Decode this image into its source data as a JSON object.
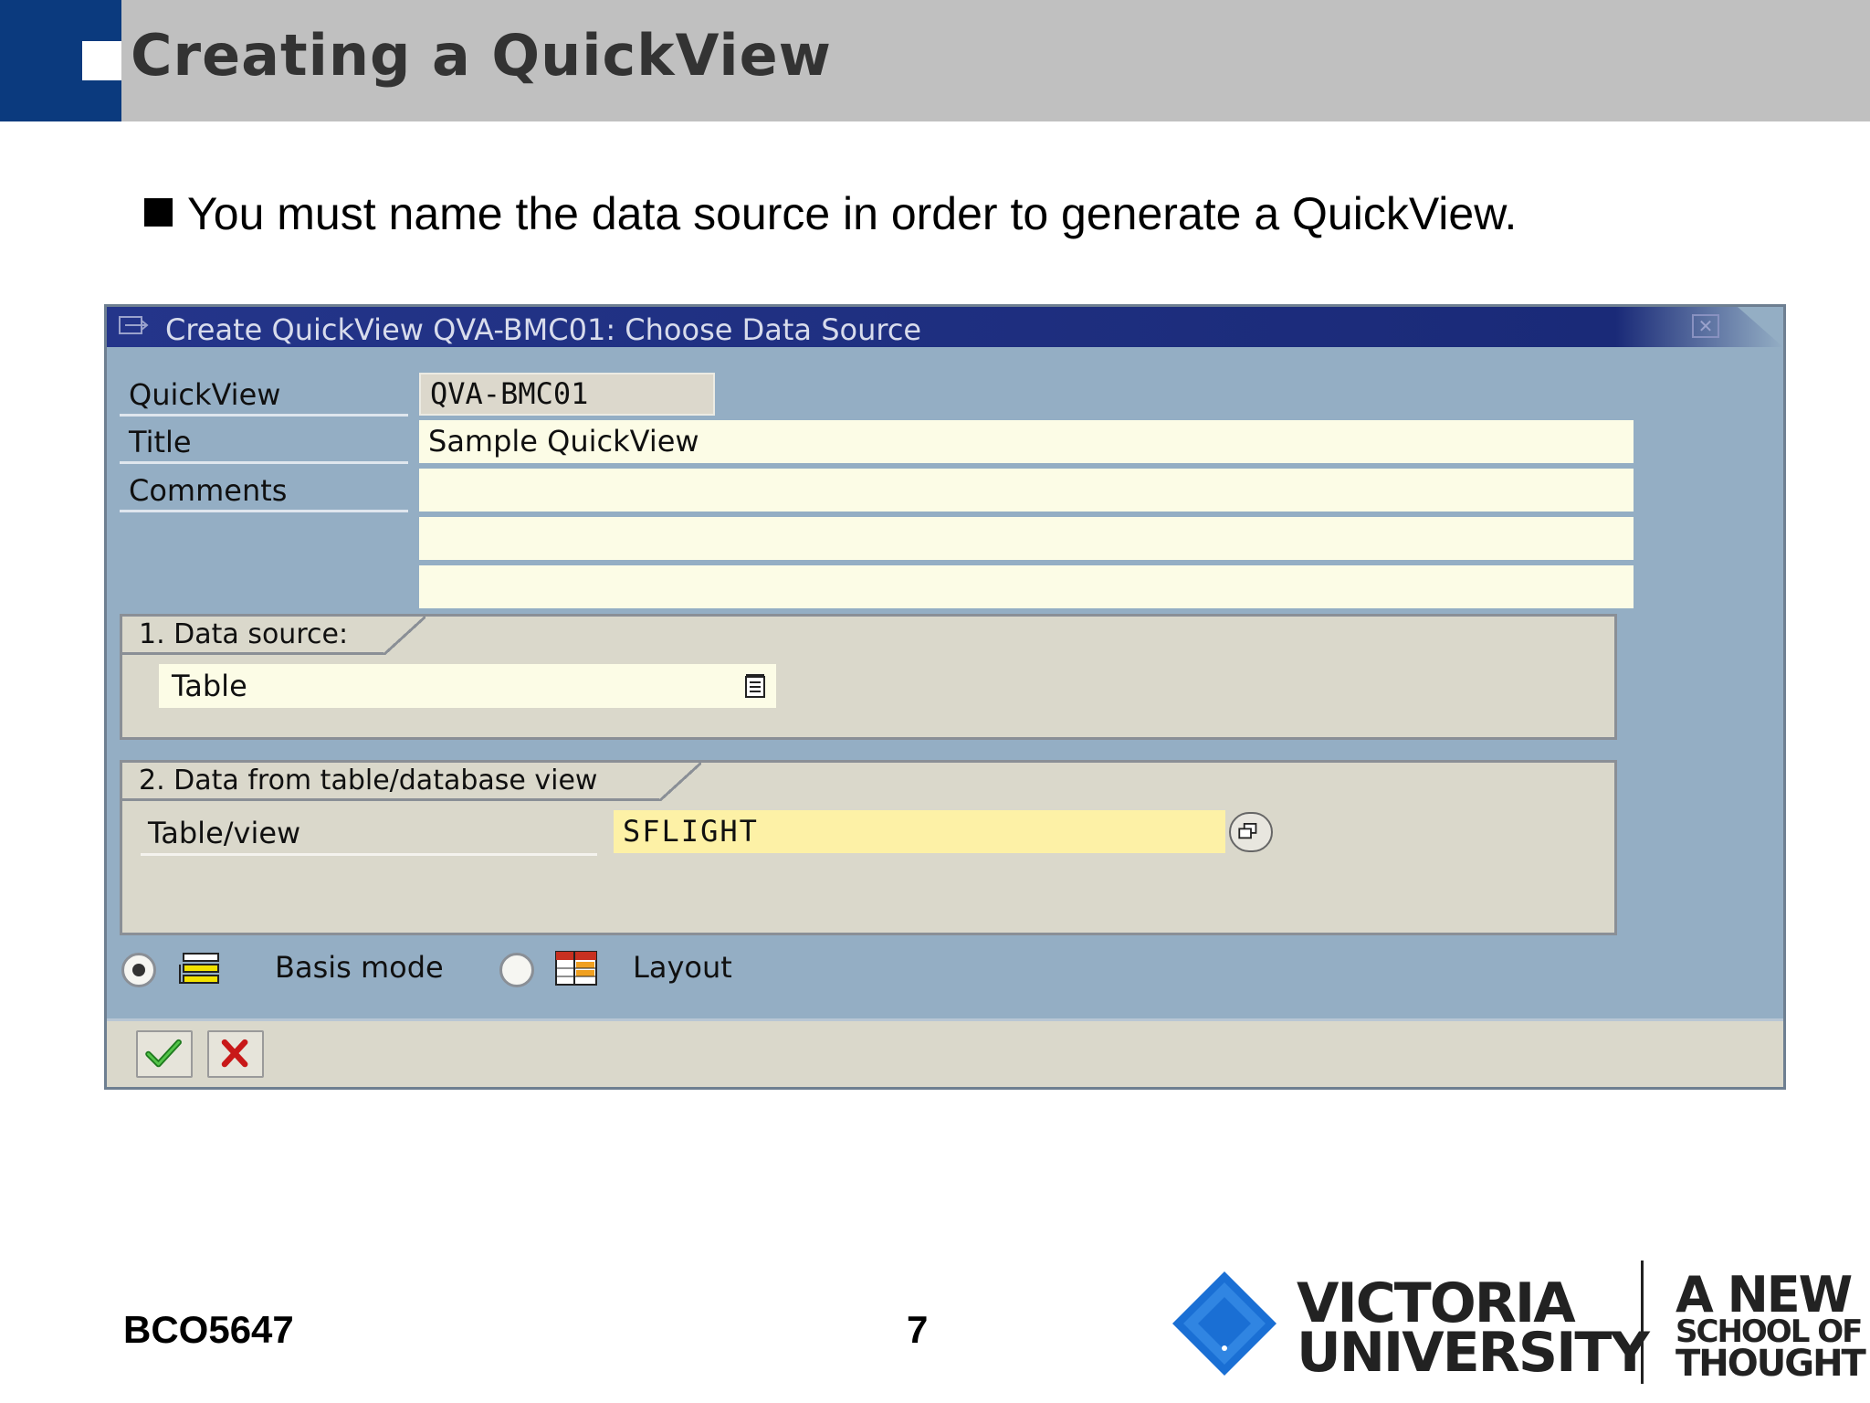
{
  "slide": {
    "title": "Creating a QuickView",
    "bullet": "You must name the data source in order to generate a QuickView.",
    "course_code": "BCO5647",
    "page_number": "7"
  },
  "dialog": {
    "title": "Create QuickView QVA-BMC01: Choose Data Source",
    "fields": {
      "quickview_label": "QuickView",
      "quickview_value": "QVA-BMC01",
      "title_label": "Title",
      "title_value": "Sample QuickView",
      "comments_label": "Comments",
      "comments_value_1": "",
      "comments_value_2": "",
      "comments_value_3": ""
    },
    "data_source_group": {
      "label": "1. Data source:",
      "selected": "Table"
    },
    "table_group": {
      "label": "2. Data from table/database view",
      "table_view_label": "Table/view",
      "table_view_value": "SFLIGHT"
    },
    "mode": {
      "basis_label": "Basis mode",
      "layout_label": "Layout",
      "selected": "basis"
    },
    "icons": {
      "confirm": "check-icon",
      "cancel": "cancel-x-icon",
      "close": "close-icon"
    }
  },
  "branding": {
    "university_line1": "VICTORIA",
    "university_line2": "UNIVERSITY",
    "slogan_line1": "A NEW",
    "slogan_line2": "SCHOOL OF",
    "slogan_line3": "THOUGHT"
  },
  "colors": {
    "header_blue": "#0b3a7e",
    "dialog_bg": "#94aec4",
    "titlebar_blue": "#1a2a78",
    "input_yellow": "#fdf1a6",
    "logo_blue": "#1a6fd4"
  }
}
